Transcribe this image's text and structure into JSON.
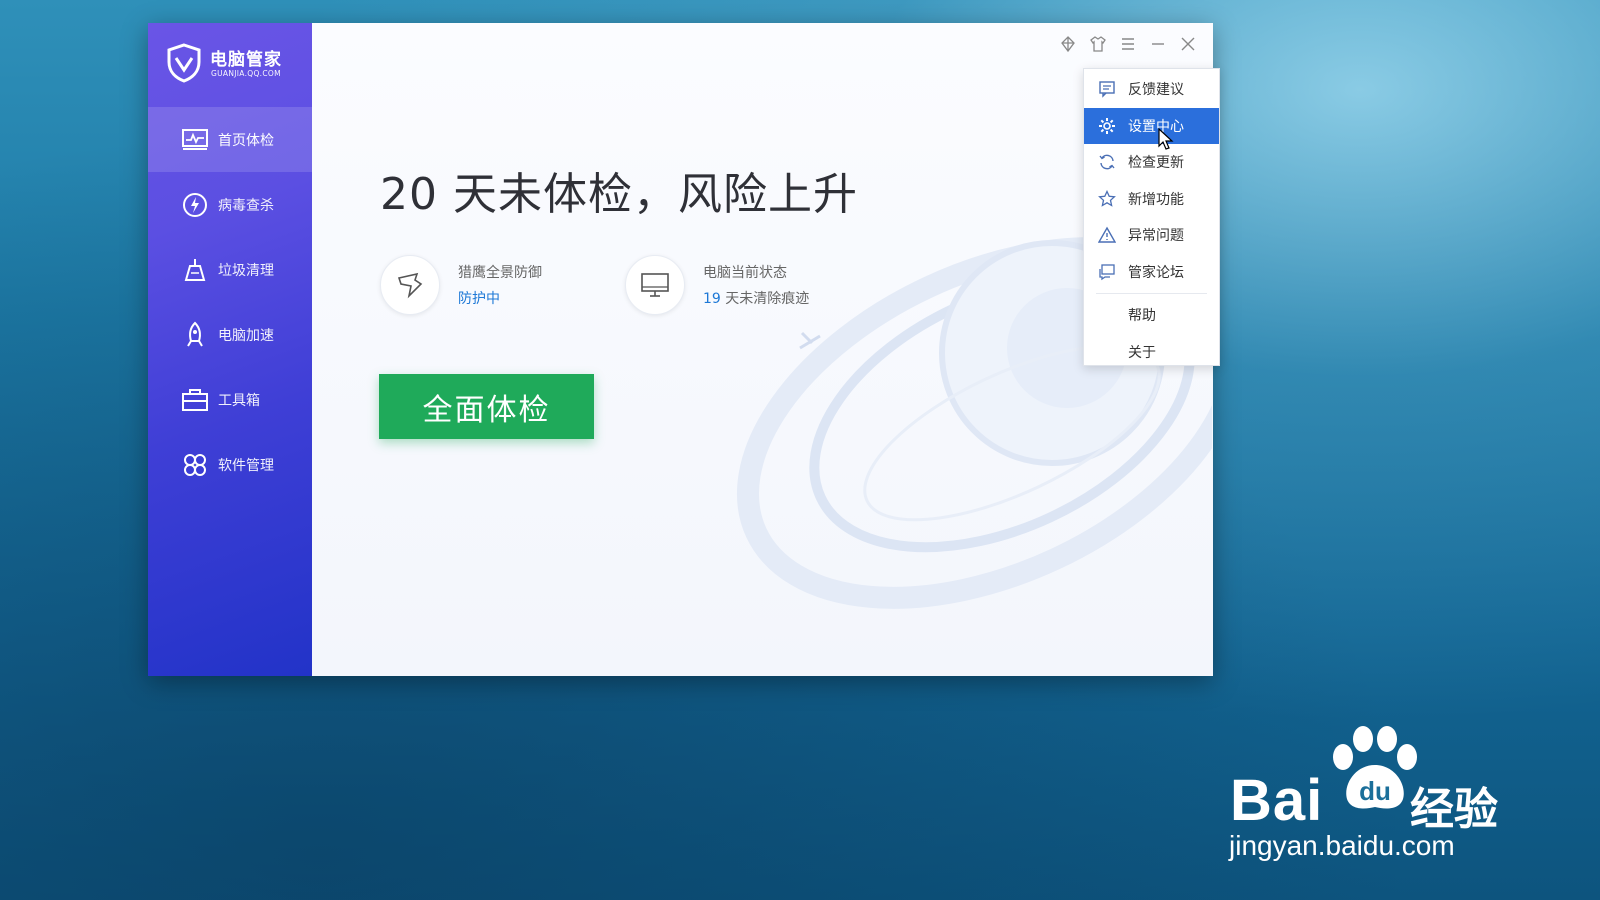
{
  "app": {
    "logo_title": "电脑管家",
    "logo_subtitle": "GUANJIA.QQ.COM",
    "accent_color": "#5b4fe2",
    "primary_button_color": "#1faa5a",
    "link_color": "#1d78d6"
  },
  "sidebar": {
    "items": [
      {
        "label": "首页体检",
        "icon": "monitor-chart-icon",
        "active": true
      },
      {
        "label": "病毒查杀",
        "icon": "lightning-shield-icon",
        "active": false
      },
      {
        "label": "垃圾清理",
        "icon": "broom-icon",
        "active": false
      },
      {
        "label": "电脑加速",
        "icon": "rocket-icon",
        "active": false
      },
      {
        "label": "工具箱",
        "icon": "toolbox-icon",
        "active": false
      },
      {
        "label": "软件管理",
        "icon": "software-grid-icon",
        "active": false
      }
    ]
  },
  "main": {
    "headline": "20 天未体检，风险上升",
    "protection": {
      "label": "猎鹰全景防御",
      "status": "防护中",
      "icon": "eagle-icon"
    },
    "pc_state": {
      "label": "电脑当前状态",
      "days": "19",
      "suffix": "天未清除痕迹",
      "icon": "monitor-icon"
    },
    "scan_button": "全面体检"
  },
  "titlebar": {
    "icons": [
      "skin-diamond-icon",
      "shirt-icon",
      "menu-icon",
      "minimize-icon",
      "close-icon"
    ]
  },
  "menu": {
    "items": [
      {
        "label": "反馈建议",
        "icon": "feedback-icon",
        "selected": false
      },
      {
        "label": "设置中心",
        "icon": "gear-icon",
        "selected": true
      },
      {
        "label": "检查更新",
        "icon": "refresh-icon",
        "selected": false
      },
      {
        "label": "新增功能",
        "icon": "star-icon",
        "selected": false
      },
      {
        "label": "异常问题",
        "icon": "warning-icon",
        "selected": false
      },
      {
        "label": "管家论坛",
        "icon": "forum-icon",
        "selected": false
      }
    ],
    "plain_items": [
      "帮助",
      "关于"
    ]
  },
  "watermark": {
    "brand": "Bai",
    "brand_du": "du",
    "cn": "经验",
    "url": "jingyan.baidu.com"
  }
}
